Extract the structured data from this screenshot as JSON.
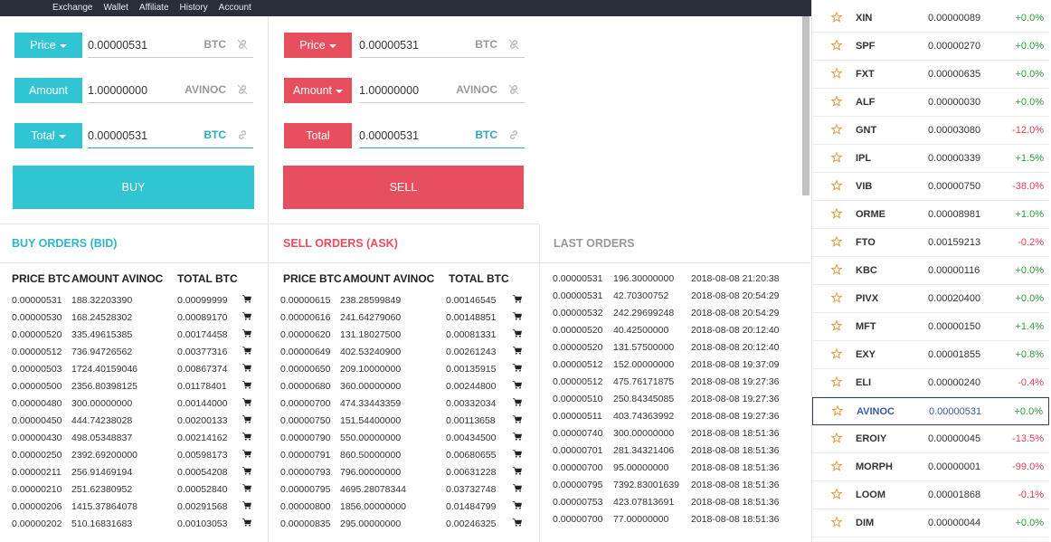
{
  "nav": {
    "items": [
      "Exchange",
      "Wallet",
      "Affiliate",
      "History",
      "Account"
    ]
  },
  "buy_form": {
    "price_label": "Price",
    "price_value": "0.00000531",
    "price_currency": "BTC",
    "amount_label": "Amount",
    "amount_value": "1.00000000",
    "amount_currency": "AVINOC",
    "total_label": "Total",
    "total_value": "0.00000531",
    "total_currency": "BTC",
    "button_label": "BUY"
  },
  "sell_form": {
    "price_label": "Price",
    "price_value": "0.00000531",
    "price_currency": "BTC",
    "amount_label": "Amount",
    "amount_value": "1.00000000",
    "amount_currency": "AVINOC",
    "total_label": "Total",
    "total_value": "0.00000531",
    "total_currency": "BTC",
    "button_label": "SELL"
  },
  "buy_orders": {
    "title": "BUY ORDERS (BID)",
    "headers": [
      "PRICE BTC",
      "AMOUNT AVINOC",
      "TOTAL BTC"
    ],
    "rows": [
      [
        "0.00000531",
        "188.32203390",
        "0.00099999"
      ],
      [
        "0.00000530",
        "168.24528302",
        "0.00089170"
      ],
      [
        "0.00000520",
        "335.49615385",
        "0.00174458"
      ],
      [
        "0.00000512",
        "736.94726562",
        "0.00377316"
      ],
      [
        "0.00000503",
        "1724.40159046",
        "0.00867374"
      ],
      [
        "0.00000500",
        "2356.80398125",
        "0.01178401"
      ],
      [
        "0.00000480",
        "300.00000000",
        "0.00144000"
      ],
      [
        "0.00000450",
        "444.74238028",
        "0.00200133"
      ],
      [
        "0.00000430",
        "498.05348837",
        "0.00214162"
      ],
      [
        "0.00000250",
        "2392.69200000",
        "0.00598173"
      ],
      [
        "0.00000211",
        "256.91469194",
        "0.00054208"
      ],
      [
        "0.00000210",
        "251.62380952",
        "0.00052840"
      ],
      [
        "0.00000206",
        "1415.37864078",
        "0.00291568"
      ],
      [
        "0.00000202",
        "510.16831683",
        "0.00103053"
      ]
    ]
  },
  "sell_orders": {
    "title": "SELL ORDERS (ASK)",
    "headers": [
      "PRICE BTC",
      "AMOUNT AVINOC",
      "TOTAL BTC"
    ],
    "rows": [
      [
        "0.00000615",
        "238.28599849",
        "0.00146545"
      ],
      [
        "0.00000616",
        "241.64279060",
        "0.00148851"
      ],
      [
        "0.00000620",
        "131.18027500",
        "0.00081331"
      ],
      [
        "0.00000649",
        "402.53240900",
        "0.00261243"
      ],
      [
        "0.00000650",
        "209.10000000",
        "0.00135915"
      ],
      [
        "0.00000680",
        "360.00000000",
        "0.00244800"
      ],
      [
        "0.00000700",
        "474.33443359",
        "0.00332034"
      ],
      [
        "0.00000750",
        "151.54400000",
        "0.00113658"
      ],
      [
        "0.00000790",
        "550.00000000",
        "0.00434500"
      ],
      [
        "0.00000791",
        "860.50000000",
        "0.00680655"
      ],
      [
        "0.00000793",
        "796.00000000",
        "0.00631228"
      ],
      [
        "0.00000795",
        "4695.28078344",
        "0.03732748"
      ],
      [
        "0.00000800",
        "1856.00000000",
        "0.01484799"
      ],
      [
        "0.00000835",
        "295.00000000",
        "0.00246325"
      ]
    ]
  },
  "last_orders": {
    "title": "LAST ORDERS",
    "rows": [
      [
        "0.00000531",
        "196.30000000",
        "2018-08-08 21:20:38"
      ],
      [
        "0.00000531",
        "42.70300752",
        "2018-08-08 20:54:29"
      ],
      [
        "0.00000532",
        "242.29699248",
        "2018-08-08 20:54:29"
      ],
      [
        "0.00000520",
        "40.42500000",
        "2018-08-08 20:12:40"
      ],
      [
        "0.00000520",
        "131.57500000",
        "2018-08-08 20:12:40"
      ],
      [
        "0.00000512",
        "152.00000000",
        "2018-08-08 19:37:09"
      ],
      [
        "0.00000512",
        "475.76171875",
        "2018-08-08 19:27:36"
      ],
      [
        "0.00000510",
        "250.84345085",
        "2018-08-08 19:27:36"
      ],
      [
        "0.00000511",
        "403.74363992",
        "2018-08-08 19:27:36"
      ],
      [
        "0.00000740",
        "300.00000000",
        "2018-08-08 18:51:36"
      ],
      [
        "0.00000701",
        "281.34321406",
        "2018-08-08 18:51:36"
      ],
      [
        "0.00000700",
        "95.00000000",
        "2018-08-08 18:51:36"
      ],
      [
        "0.00000795",
        "7392.83001639",
        "2018-08-08 18:51:36"
      ],
      [
        "0.00000753",
        "423.07813691",
        "2018-08-08 18:51:36"
      ],
      [
        "0.00000700",
        "77.00000000",
        "2018-08-08 18:51:36"
      ]
    ]
  },
  "markets": [
    {
      "symbol": "XIN",
      "price": "0.00000089",
      "change": "+0.0%",
      "dir": "up"
    },
    {
      "symbol": "SPF",
      "price": "0.00000270",
      "change": "+0.0%",
      "dir": "up"
    },
    {
      "symbol": "FXT",
      "price": "0.00000635",
      "change": "+0.0%",
      "dir": "up"
    },
    {
      "symbol": "ALF",
      "price": "0.00000030",
      "change": "+0.0%",
      "dir": "up"
    },
    {
      "symbol": "GNT",
      "price": "0.00003080",
      "change": "-12.0%",
      "dir": "down"
    },
    {
      "symbol": "IPL",
      "price": "0.00000339",
      "change": "+1.5%",
      "dir": "up"
    },
    {
      "symbol": "VIB",
      "price": "0.00000750",
      "change": "-38.0%",
      "dir": "down"
    },
    {
      "symbol": "ORME",
      "price": "0.00008981",
      "change": "+1.0%",
      "dir": "up"
    },
    {
      "symbol": "FTO",
      "price": "0.00159213",
      "change": "-0.2%",
      "dir": "down"
    },
    {
      "symbol": "KBC",
      "price": "0.00000116",
      "change": "+0.0%",
      "dir": "up"
    },
    {
      "symbol": "PIVX",
      "price": "0.00020400",
      "change": "+0.0%",
      "dir": "up"
    },
    {
      "symbol": "MFT",
      "price": "0.00000150",
      "change": "+1.4%",
      "dir": "up"
    },
    {
      "symbol": "EXY",
      "price": "0.00001855",
      "change": "+0.8%",
      "dir": "up"
    },
    {
      "symbol": "ELI",
      "price": "0.00000240",
      "change": "-0.4%",
      "dir": "down"
    },
    {
      "symbol": "AVINOC",
      "price": "0.00000531",
      "change": "+0.0%",
      "dir": "up",
      "selected": true
    },
    {
      "symbol": "EROIY",
      "price": "0.00000045",
      "change": "-13.5%",
      "dir": "down"
    },
    {
      "symbol": "MORPH",
      "price": "0.00000001",
      "change": "-99.0%",
      "dir": "down"
    },
    {
      "symbol": "LOOM",
      "price": "0.00001868",
      "change": "-0.1%",
      "dir": "down"
    },
    {
      "symbol": "DIM",
      "price": "0.00000044",
      "change": "+0.0%",
      "dir": "up"
    }
  ],
  "colors": {
    "buy": "#31c4d3",
    "sell": "#e84f5e",
    "up": "#2e9e3a",
    "down": "#d9434f",
    "nav": "#2a2d3a"
  },
  "icons": {
    "link": "link-icon",
    "cart": "cart-icon",
    "star": "star-icon",
    "caret": "caret-down-icon"
  }
}
